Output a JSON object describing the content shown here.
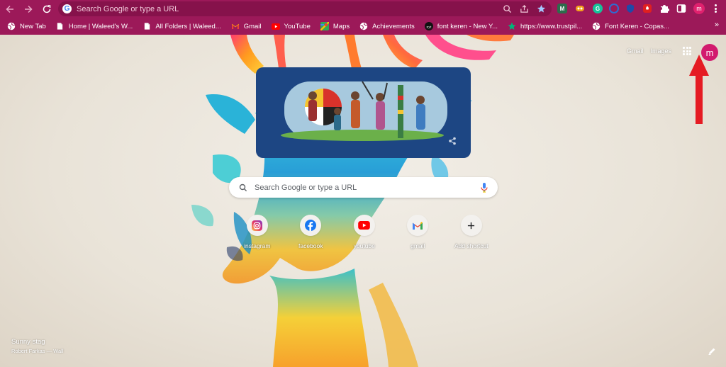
{
  "colors": {
    "chrome_frame": "#9c1959",
    "omnibox": "#86124b",
    "accent": "#e0216e",
    "annotation_arrow": "#e51b23",
    "doodle_bg": "#1d4683"
  },
  "omnibox": {
    "placeholder": "Search Google or type a URL"
  },
  "toolbar": {
    "profile_initial": "m"
  },
  "extensions": [
    {
      "icon": "m-extension-icon",
      "text": "M",
      "color": "#2d6b4c"
    },
    {
      "icon": "grammar-extension-icon",
      "text": "",
      "color": "#f3a21c"
    },
    {
      "icon": "grammarly-icon",
      "text": "G",
      "color": "#15c39a"
    },
    {
      "icon": "globe-extension-icon",
      "text": "",
      "color": "#2e6cd1"
    },
    {
      "icon": "shield-extension-icon",
      "text": "",
      "color": "#1f4aa8"
    },
    {
      "icon": "security-extension-icon",
      "text": "",
      "color": "#e02020"
    }
  ],
  "bookmarks": [
    {
      "label": "New Tab",
      "icon": "globe-icon"
    },
    {
      "label": "Home | Waleed's W...",
      "icon": "page-icon"
    },
    {
      "label": "All Folders | Waleed...",
      "icon": "page-icon"
    },
    {
      "label": "Gmail",
      "icon": "gmail-icon"
    },
    {
      "label": "YouTube",
      "icon": "youtube-icon"
    },
    {
      "label": "Maps",
      "icon": "maps-icon"
    },
    {
      "label": "Achievements",
      "icon": "globe-icon"
    },
    {
      "label": "font keren - New Y...",
      "icon": "nyt-icon"
    },
    {
      "label": "https://www.trustpil...",
      "icon": "star-icon"
    },
    {
      "label": "Font Keren - Copas...",
      "icon": "globe-icon"
    }
  ],
  "bookmarks_more": "»",
  "page": {
    "links": {
      "gmail": "Gmail",
      "images": "Images"
    },
    "account_initial": "m",
    "search": {
      "placeholder": "Search Google or type a URL"
    },
    "shortcuts": [
      {
        "label": "instagram",
        "icon": "instagram-icon"
      },
      {
        "label": "facebook",
        "icon": "facebook-icon"
      },
      {
        "label": "youtube",
        "icon": "youtube-icon"
      },
      {
        "label": "gmail",
        "icon": "gmail-icon"
      },
      {
        "label": "Add shortcut",
        "icon": "plus-icon"
      }
    ],
    "background": {
      "title": "Sunny stag",
      "author": "Robert Farkas — Wall"
    }
  }
}
